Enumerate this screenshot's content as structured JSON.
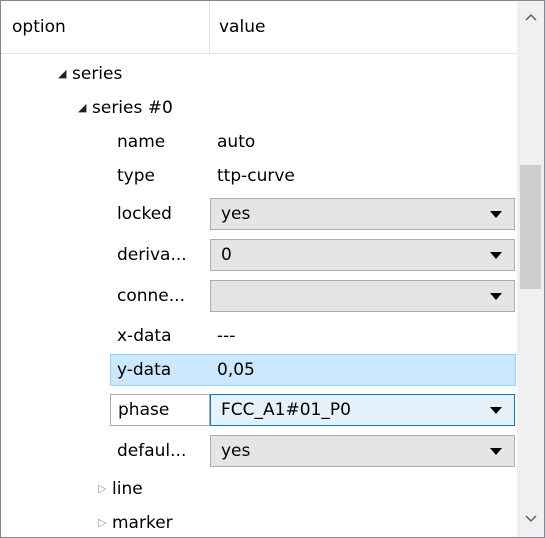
{
  "header": {
    "option_label": "option",
    "value_label": "value"
  },
  "tree": {
    "series": {
      "label": "series",
      "expanded": true
    },
    "series0": {
      "label": "series #0",
      "expanded": true
    },
    "rows": {
      "name": {
        "label": "name",
        "value": "auto"
      },
      "type": {
        "label": "type",
        "value": "ttp-curve"
      },
      "locked": {
        "label": "locked",
        "value": "yes"
      },
      "deriva": {
        "label": "deriva...",
        "value": "0"
      },
      "conne": {
        "label": "conne...",
        "value": ""
      },
      "xdata": {
        "label": "x-data",
        "value": "---"
      },
      "ydata": {
        "label": "y-data",
        "value": "0,05"
      },
      "phase": {
        "label": "phase",
        "value": "FCC_A1#01_P0"
      },
      "defaul": {
        "label": "defaul...",
        "value": "yes"
      }
    },
    "line": {
      "label": "line",
      "expanded": false
    },
    "marker": {
      "label": "marker",
      "expanded": false
    }
  },
  "colors": {
    "selection_bg": "#cce8ff",
    "selection_border": "#99d1ff",
    "focus_combo_border": "#0078d7",
    "combo_bg": "#e5e5e5"
  },
  "icons": {
    "expanded": "triangle-down-right-icon",
    "collapsed": "triangle-right-outline-icon",
    "dropdown": "chevron-down-icon"
  }
}
